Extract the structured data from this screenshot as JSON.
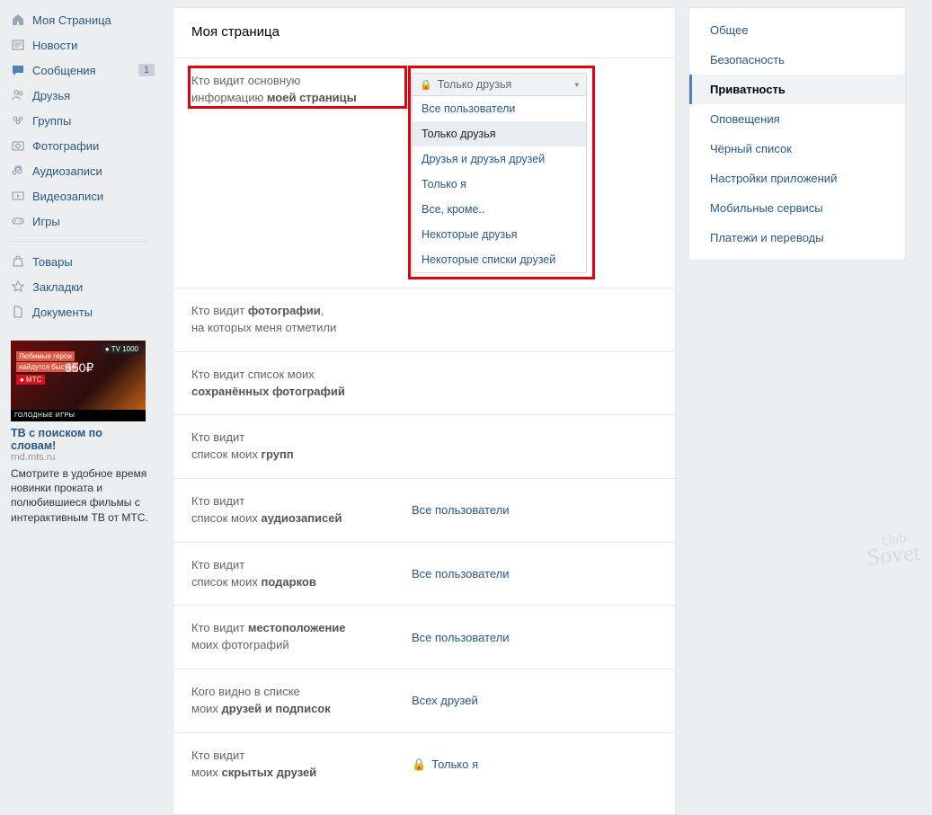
{
  "sidebar": {
    "items": [
      {
        "icon": "home",
        "label": "Моя Страница"
      },
      {
        "icon": "news",
        "label": "Новости"
      },
      {
        "icon": "msg",
        "label": "Сообщения",
        "badge": "1"
      },
      {
        "icon": "friends",
        "label": "Друзья"
      },
      {
        "icon": "groups",
        "label": "Группы"
      },
      {
        "icon": "photo",
        "label": "Фотографии"
      },
      {
        "icon": "audio",
        "label": "Аудиозаписи"
      },
      {
        "icon": "video",
        "label": "Видеозаписи"
      },
      {
        "icon": "games",
        "label": "Игры"
      }
    ],
    "items2": [
      {
        "icon": "market",
        "label": "Товары"
      },
      {
        "icon": "fav",
        "label": "Закладки"
      },
      {
        "icon": "docs",
        "label": "Документы"
      }
    ]
  },
  "ad": {
    "pill": "● TV 1000",
    "line1": "Любимые герои",
    "line2": "найдутся быстро",
    "price": "650₽",
    "mts": "● МТС",
    "footer": "ГОЛОДНЫЕ ИГРЫ",
    "title": "ТВ с поиском по словам!",
    "domain": "rnd.mts.ru",
    "desc": "Смотрите в удобное время новинки проката и полюбившиеся фильмы с интерактивным ТВ от МТС."
  },
  "main": {
    "title": "Моя страница",
    "rows": [
      {
        "l1": "Кто видит основную",
        "l2": "информацию ",
        "b": "моей страницы",
        "value": "Только друзья",
        "locked": true,
        "dd": true
      },
      {
        "l1": "Кто видит ",
        "b": "фотографии",
        "l2": ",",
        "l3": "на которых меня отметили",
        "value": ""
      },
      {
        "l1": "Кто видит список моих",
        "l2": "",
        "b": "сохранённых фотографий",
        "value": ""
      },
      {
        "l1": "Кто видит",
        "l2": "список моих ",
        "b": "групп",
        "value": ""
      },
      {
        "l1": "Кто видит",
        "l2": "список моих ",
        "b": "аудиозаписей",
        "value": "Все пользователи"
      },
      {
        "l1": "Кто видит",
        "l2": "список моих ",
        "b": "подарков",
        "value": "Все пользователи"
      },
      {
        "l1": "Кто видит ",
        "b": "местоположение",
        "l2": "",
        "l3": "моих фотографий",
        "value": "Все пользователи"
      },
      {
        "l1": "Кого видно в списке",
        "l2": "моих ",
        "b": "друзей и подписок",
        "value": "Всех друзей"
      },
      {
        "l1": "Кто видит",
        "l2": "моих ",
        "b": "скрытых друзей",
        "value": "Только я",
        "locked": true
      }
    ],
    "dropdown": {
      "selected": "Только друзья",
      "options": [
        "Все пользователи",
        "Только друзья",
        "Друзья и друзья друзей",
        "Только я",
        "Все, кроме..",
        "Некоторые друзья",
        "Некоторые списки друзей"
      ]
    }
  },
  "tabs": [
    "Общее",
    "Безопасность",
    "Приватность",
    "Оповещения",
    "Чёрный список",
    "Настройки приложений",
    "Мобильные сервисы",
    "Платежи и переводы"
  ],
  "active_tab": "Приватность",
  "watermark": {
    "l1": "club",
    "l2": "Sovet"
  }
}
